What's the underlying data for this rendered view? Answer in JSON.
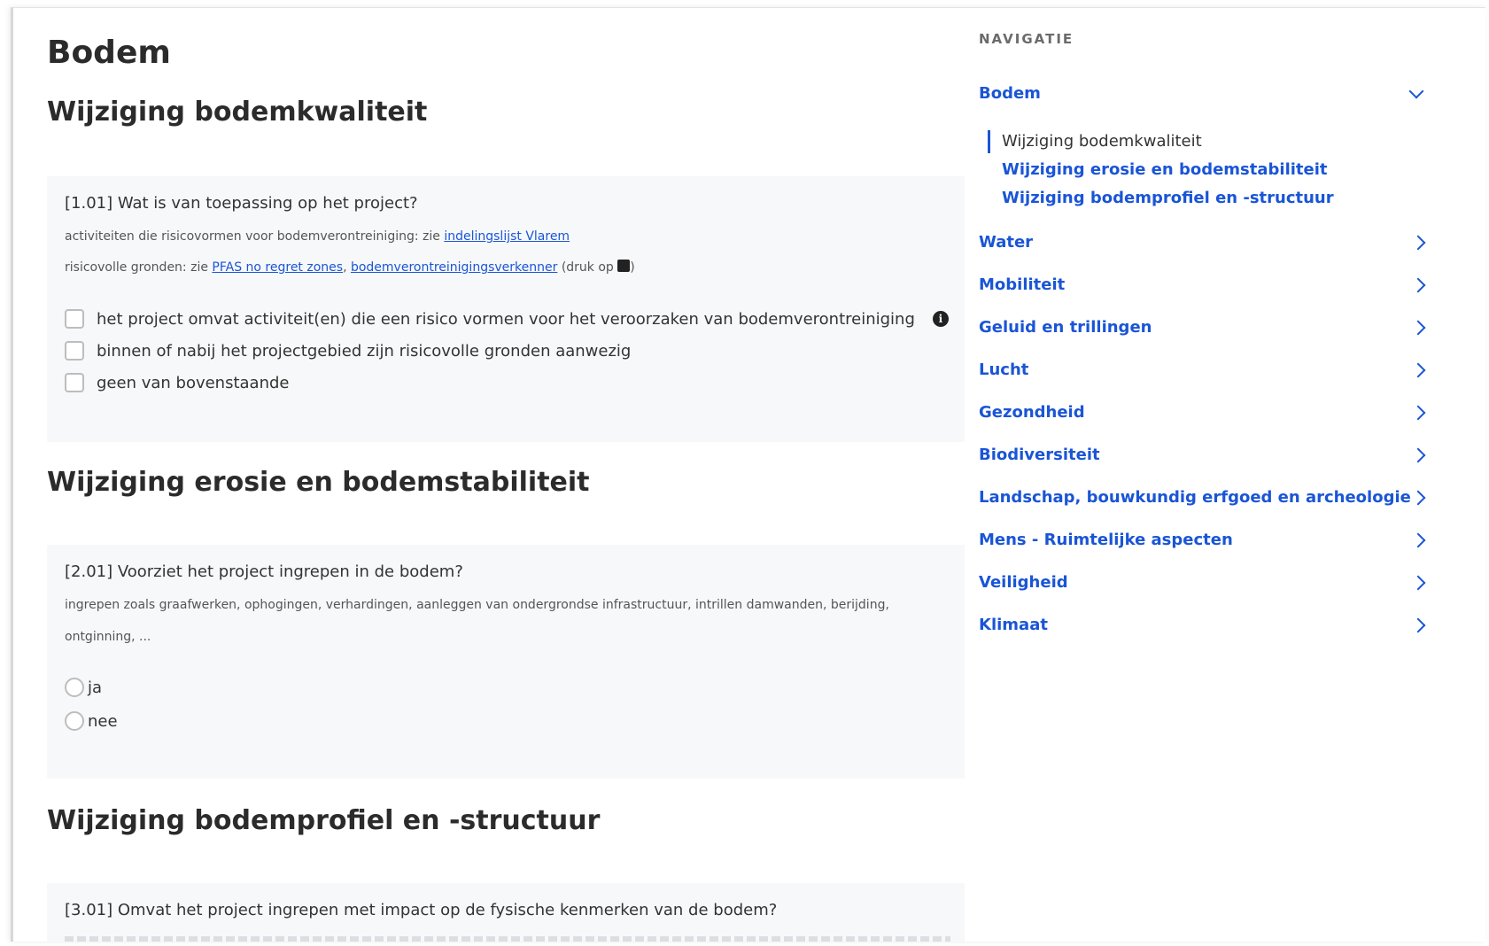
{
  "page": {
    "title": "Bodem"
  },
  "sections": [
    {
      "title": "Wijziging bodemkwaliteit",
      "question": {
        "title": "[1.01] Wat is van toepassing op het project?",
        "help_line1_text": "activiteiten die risicovormen voor bodemverontreiniging: zie",
        "help_line1_link": "indelingslijst Vlarem",
        "help_line2_text": "risicovolle gronden: zie",
        "help_line2_link1": "PFAS no regret zones",
        "help_line2_sep": ",",
        "help_line2_link2": "bodemverontreinigingsverkenner",
        "help_line2_suffix": "(druk op",
        "help_line2_end": ")",
        "options": [
          "het project omvat activiteit(en) die een risico vormen voor het veroorzaken van bodemverontreiniging",
          "binnen of nabij het projectgebied zijn risicovolle gronden aanwezig",
          "geen van bovenstaande"
        ],
        "info_glyph": "i"
      }
    },
    {
      "title": "Wijziging erosie en bodemstabiliteit",
      "question": {
        "title": "[2.01] Voorziet het project ingrepen in de bodem?",
        "help_line1": "ingrepen zoals graafwerken, ophogingen, verhardingen, aanleggen van ondergrondse infrastructuur, intrillen damwanden, berijding,",
        "help_line2": "ontginning, ...",
        "options": [
          "ja",
          "nee"
        ]
      }
    },
    {
      "title": "Wijziging bodemprofiel en -structuur",
      "question": {
        "title": "[3.01] Omvat het project ingrepen met impact op de fysische kenmerken van de bodem?"
      }
    }
  ],
  "nav": {
    "heading": "NAVIGATIE",
    "items": [
      {
        "label": "Bodem",
        "expanded": true,
        "sub": [
          "Wijziging bodemkwaliteit",
          "Wijziging erosie en bodemstabiliteit",
          "Wijziging bodemprofiel en -structuur"
        ],
        "active_sub": 0
      },
      {
        "label": "Water"
      },
      {
        "label": "Mobiliteit"
      },
      {
        "label": "Geluid en trillingen"
      },
      {
        "label": "Lucht"
      },
      {
        "label": "Gezondheid"
      },
      {
        "label": "Biodiversiteit"
      },
      {
        "label": "Landschap, bouwkundig erfgoed en archeologie"
      },
      {
        "label": "Mens - Ruimtelijke aspecten"
      },
      {
        "label": "Veiligheid"
      },
      {
        "label": "Klimaat"
      }
    ]
  },
  "colors": {
    "link": "#1a55d6",
    "card_bg": "#f7f8fa",
    "text": "#2b2b2b"
  }
}
